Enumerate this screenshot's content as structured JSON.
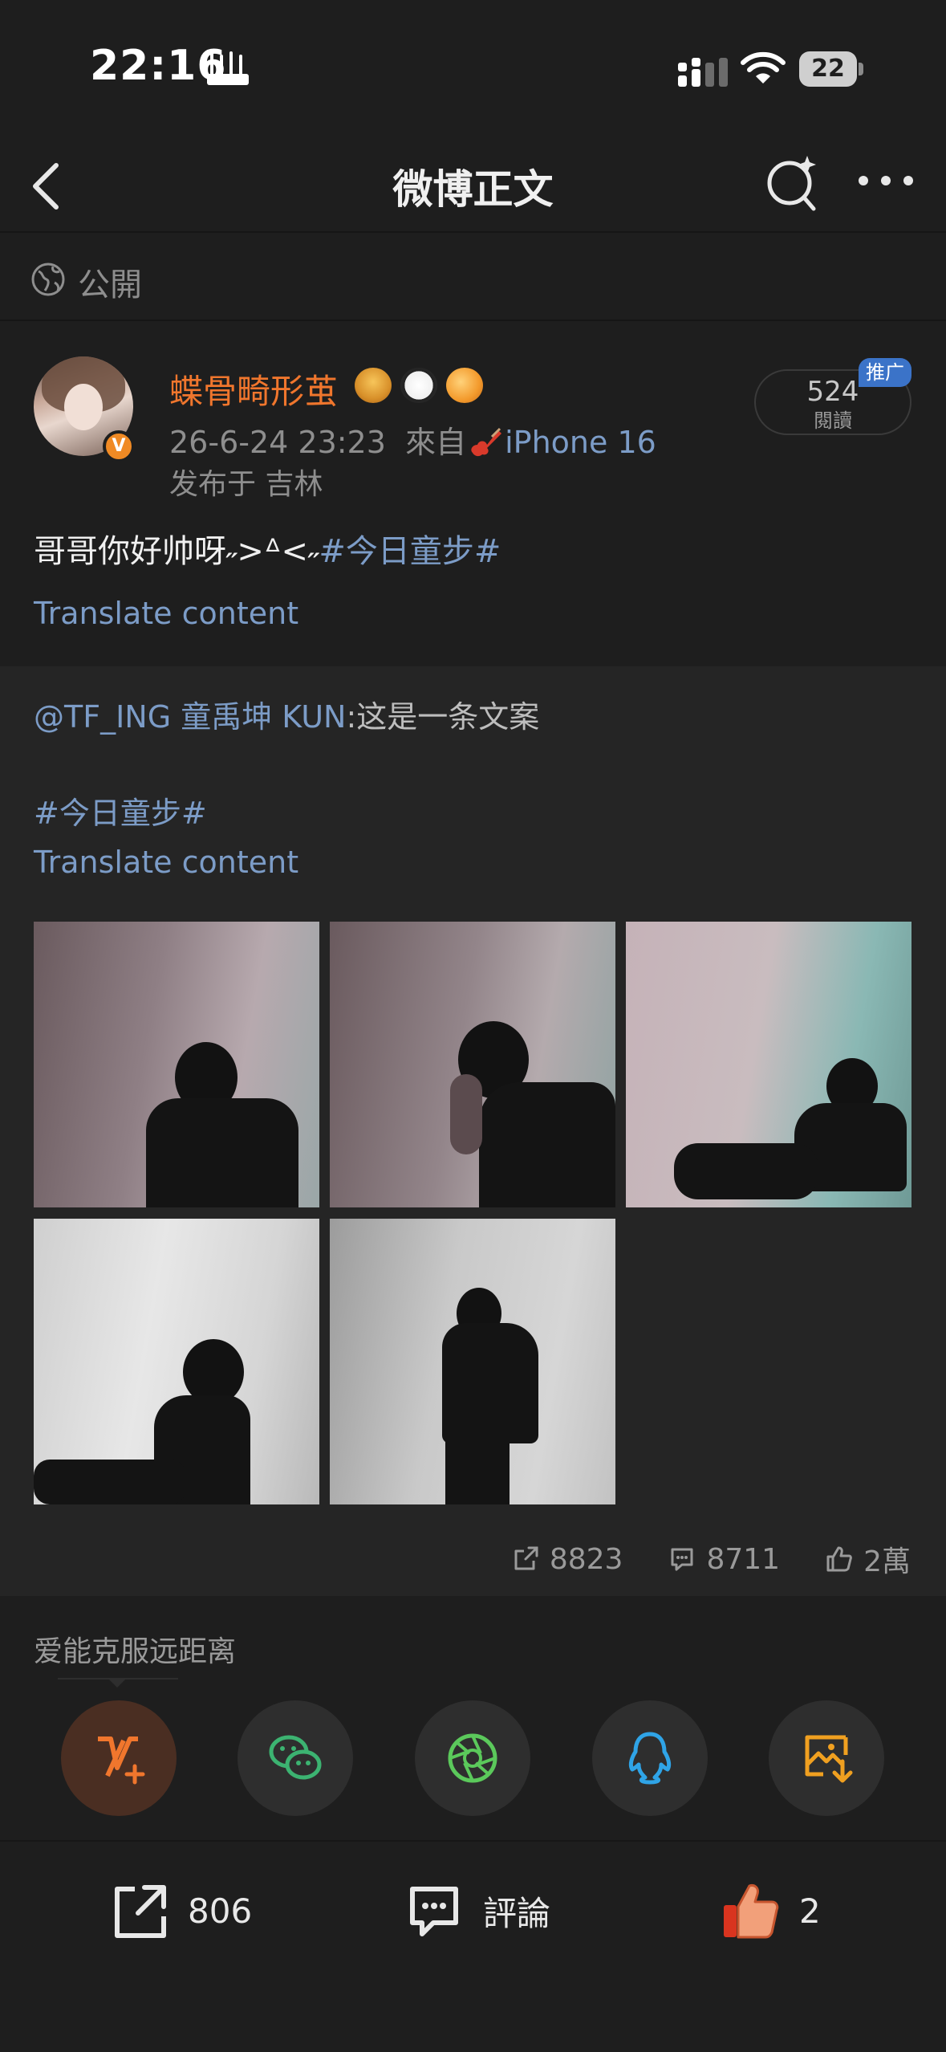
{
  "status": {
    "time": "22:16",
    "battery": "22"
  },
  "nav": {
    "title": "微博正文"
  },
  "visibility": {
    "label": "公開"
  },
  "post": {
    "username": "蝶骨畸形茧",
    "date": "26-6-24 23:23",
    "from_prefix": "來自",
    "device": "iPhone 16",
    "location": "发布于 吉林",
    "reads_count": "524",
    "reads_label": "閱讀",
    "promo_label": "推广",
    "text": "哥哥你好帅呀˶>ᐞ<˶",
    "hashtag": "#今日童步#",
    "translate": "Translate content"
  },
  "repost": {
    "mention": "@TF_ING 童禹坤 KUN",
    "text": ":这是一条文案",
    "hashtag": "#今日童步#",
    "translate": "Translate content",
    "stats": {
      "reposts": "8823",
      "comments": "8711",
      "likes": "2萬"
    }
  },
  "share": {
    "hint": "爱能克服远距离"
  },
  "actions": {
    "repost_count": "806",
    "comment_label": "評論",
    "like_count": "2"
  },
  "colors": {
    "accent_orange": "#f0762d",
    "link_blue": "#7c9cc7",
    "background": "#1e1e1e"
  },
  "icons": [
    "back-icon",
    "search-sparkle-icon",
    "more-icon",
    "globe-icon",
    "verified-badge-icon",
    "repost-icon",
    "comment-icon",
    "like-icon",
    "weibo-v-plus-icon",
    "wechat-icon",
    "moments-icon",
    "qq-icon",
    "save-image-icon"
  ]
}
